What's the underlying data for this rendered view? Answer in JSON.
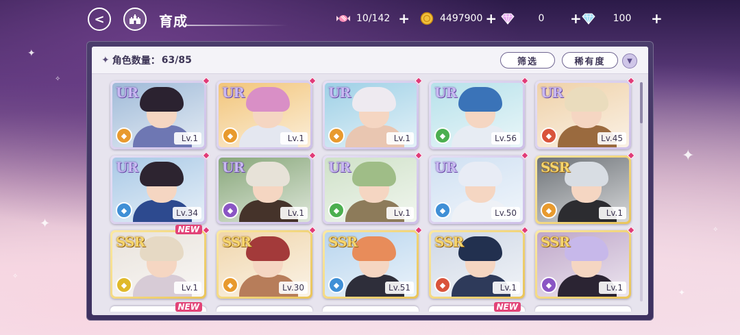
{
  "header": {
    "back_label": "<",
    "title": "育成",
    "resources": [
      {
        "icon": "candy-icon",
        "value": "10/142"
      },
      {
        "icon": "gold-coin-icon",
        "value": "4497900"
      },
      {
        "icon": "pink-diamond-icon",
        "value": "0"
      },
      {
        "icon": "blue-diamond-icon",
        "value": "100"
      }
    ],
    "plus_label": "+"
  },
  "panel": {
    "count_label": "角色数量：",
    "count_value": "63/85",
    "filter_label": "筛选",
    "rarity_sort_label": "稀有度",
    "sort_toggle_label": "▼"
  },
  "colors": {
    "ur": "#c9b8f2",
    "ssr": "#f6d56b",
    "gem": "#e03b78"
  },
  "cards": [
    {
      "rarity": "UR",
      "level": "Lv.1",
      "element": "orange",
      "hair": "#2b2230",
      "bg": "#9fbad8",
      "body": "#6e77b3",
      "new": false
    },
    {
      "rarity": "UR",
      "level": "Lv.1",
      "element": "orange",
      "hair": "#d98fc6",
      "bg": "#f2c57a",
      "body": "#e4e7f0",
      "new": false
    },
    {
      "rarity": "UR",
      "level": "Lv.1",
      "element": "orange",
      "hair": "#eeeaf0",
      "bg": "#9ed0e6",
      "body": "#e9c6b1",
      "new": false
    },
    {
      "rarity": "UR",
      "level": "Lv.56",
      "element": "green",
      "hair": "#3a73b8",
      "bg": "#b6e1ea",
      "body": "#e7ecf3",
      "new": false
    },
    {
      "rarity": "UR",
      "level": "Lv.45",
      "element": "red",
      "hair": "#eadcbd",
      "bg": "#efd1a8",
      "body": "#9a6a3e",
      "new": false
    },
    {
      "rarity": "UR",
      "level": "Lv.34",
      "element": "blue",
      "hair": "#2d2430",
      "bg": "#a9c9e6",
      "body": "#2d4a8f",
      "new": false
    },
    {
      "rarity": "UR",
      "level": "Lv.1",
      "element": "purple",
      "hair": "#e7e2d8",
      "bg": "#88a77a",
      "body": "#45332a",
      "new": false
    },
    {
      "rarity": "UR",
      "level": "Lv.1",
      "element": "green",
      "hair": "#9fbd87",
      "bg": "#cfe1c8",
      "body": "#8d7b5a",
      "new": false
    },
    {
      "rarity": "UR",
      "level": "Lv.50",
      "element": "blue",
      "hair": "#e8ecf5",
      "bg": "#cfe0f2",
      "body": "#eef1f6",
      "new": false
    },
    {
      "rarity": "SSR",
      "level": "Lv.1",
      "element": "orange",
      "hair": "#d8dde3",
      "bg": "#6e7378",
      "body": "#2c2c30",
      "new": false
    },
    {
      "rarity": "SSR",
      "level": "Lv.1",
      "element": "yellow",
      "hair": "#e6d9c4",
      "bg": "#e9e3dc",
      "body": "#d7cbd6",
      "new": true
    },
    {
      "rarity": "SSR",
      "level": "Lv.30",
      "element": "orange",
      "hair": "#a33a3a",
      "bg": "#f0d6ac",
      "body": "#b77d5a",
      "new": false
    },
    {
      "rarity": "SSR",
      "level": "Lv.51",
      "element": "blue",
      "hair": "#e88c5a",
      "bg": "#b8d5ee",
      "body": "#2e2e3a",
      "new": false
    },
    {
      "rarity": "SSR",
      "level": "Lv.1",
      "element": "red",
      "hair": "#22304f",
      "bg": "#cfd8e6",
      "body": "#2e3a5a",
      "new": false
    },
    {
      "rarity": "SSR",
      "level": "Lv.1",
      "element": "purple",
      "hair": "#c7b8ea",
      "bg": "#bfa7c9",
      "body": "#2b2433",
      "new": false
    }
  ],
  "peek_row_new_flags": [
    true,
    false,
    false,
    true,
    false
  ],
  "new_label": "NEW"
}
